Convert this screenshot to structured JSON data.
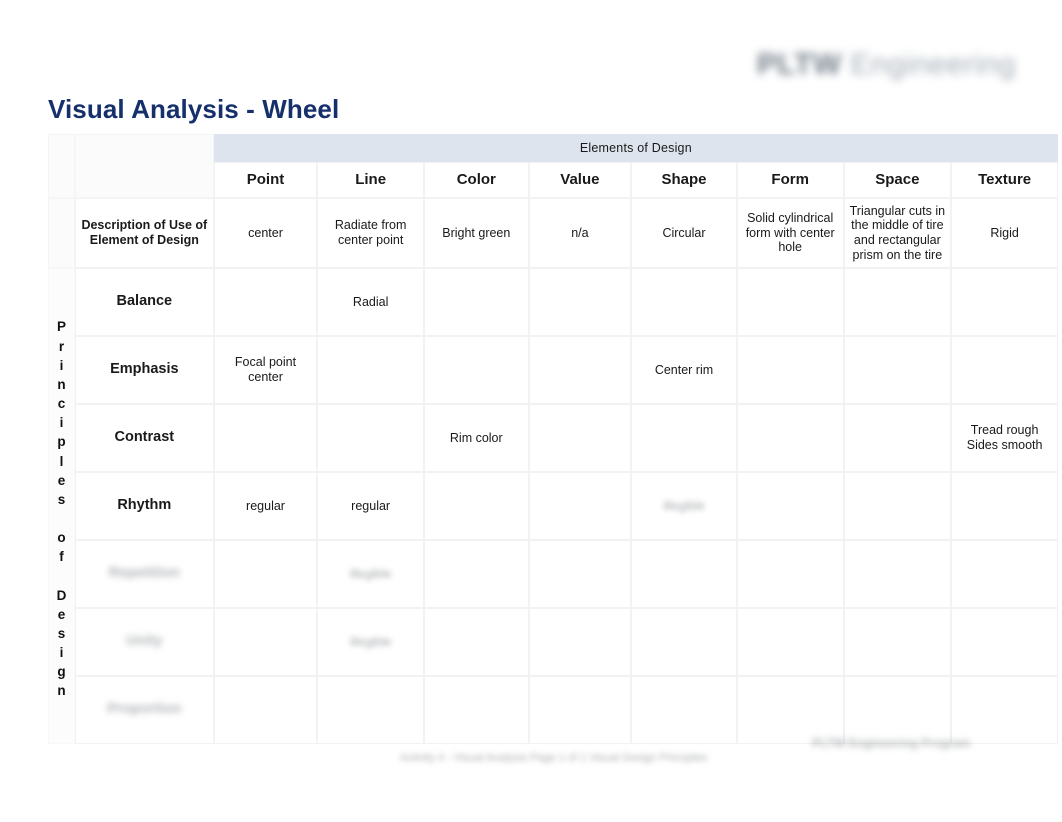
{
  "header": {
    "logo_mark": "PLTW",
    "logo_word": "Engineering"
  },
  "title": "Visual Analysis - Wheel",
  "table": {
    "banner": "Elements of Design",
    "row_axis_label": "Principles of Design",
    "row_axis_label_vertical": "P\nr\ni\nn\nc\ni\np\nl\ne\ns\n\no\nf\n\nD\ne\ns\ni\ng\nn",
    "columns": [
      "Point",
      "Line",
      "Color",
      "Value",
      "Shape",
      "Form",
      "Space",
      "Texture"
    ],
    "description_row": {
      "label": "Description of Use of Element of Design",
      "cells": [
        "center",
        "Radiate from center point",
        "Bright green",
        "n/a",
        "Circular",
        "Solid cylindrical form with center hole",
        "Triangular cuts in the middle of tire and rectangular prism on the tire",
        "Rigid"
      ]
    },
    "rows": [
      {
        "label": "Balance",
        "label_blurred": false,
        "cells": [
          "",
          "Radial",
          "",
          "",
          "",
          "",
          "",
          ""
        ],
        "blurred_cells": []
      },
      {
        "label": "Emphasis",
        "label_blurred": false,
        "cells": [
          "Focal point center",
          "",
          "",
          "",
          "Center rim",
          "",
          "",
          ""
        ],
        "blurred_cells": []
      },
      {
        "label": "Contrast",
        "label_blurred": false,
        "cells": [
          "",
          "",
          "Rim color",
          "",
          "",
          "",
          "",
          "Tread rough Sides smooth"
        ],
        "blurred_cells": []
      },
      {
        "label": "Rhythm",
        "label_blurred": false,
        "cells": [
          "regular",
          "regular",
          "",
          "",
          "illegible",
          "",
          "",
          ""
        ],
        "blurred_cells": [
          4
        ]
      },
      {
        "label": "Repetition",
        "label_blurred": true,
        "cells": [
          "",
          "illegible",
          "",
          "",
          "",
          "",
          "",
          ""
        ],
        "blurred_cells": [
          1
        ]
      },
      {
        "label": "Unity",
        "label_blurred": true,
        "cells": [
          "",
          "illegible",
          "",
          "",
          "",
          "",
          "",
          ""
        ],
        "blurred_cells": [
          1
        ]
      },
      {
        "label": "Proportion",
        "label_blurred": true,
        "cells": [
          "",
          "",
          "",
          "",
          "",
          "",
          "",
          ""
        ],
        "blurred_cells": []
      }
    ]
  },
  "footer": {
    "text": "Activity 4 - Visual Analysis Page 1 of 1 Visual Design Principles",
    "badge": "PLTW Engineering Program"
  },
  "colors": {
    "title": "#15306b",
    "banner_bg": "#dde4ee",
    "cell_bg": "#ffffff",
    "grid": "#f1f2f3"
  }
}
